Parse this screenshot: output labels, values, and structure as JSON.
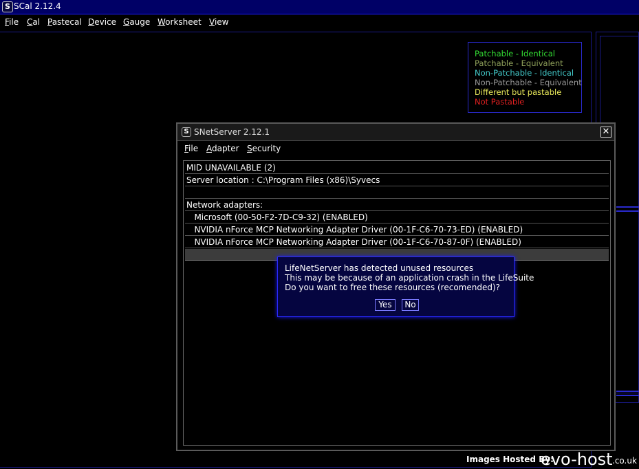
{
  "app": {
    "title": "SCal 2.12.4",
    "logo_letter": "S",
    "menu": [
      "File",
      "Cal",
      "Pastecal",
      "Device",
      "Gauge",
      "Worksheet",
      "View"
    ]
  },
  "legend": {
    "items": [
      {
        "label": "Patchable - Identical",
        "color": "#33dd33"
      },
      {
        "label": "Patchable - Equivalent",
        "color": "#8fa15a"
      },
      {
        "label": "Non-Patchable - Identical",
        "color": "#44cccc"
      },
      {
        "label": "Non-Patchable - Equivalent",
        "color": "#9a9a9a"
      },
      {
        "label": "Different but pastable",
        "color": "#e8e85a"
      },
      {
        "label": "Not Pastable",
        "color": "#e02020"
      }
    ]
  },
  "snetserver": {
    "title": "SNetServer 2.12.1",
    "logo_letter": "S",
    "close_label": "✕",
    "menu": [
      "File",
      "Adapter",
      "Security"
    ],
    "rows": [
      "MID UNAVAILABLE (2)",
      "Server location : C:\\Program Files (x86)\\Syvecs",
      "",
      "Network adapters:",
      "   Microsoft (00-50-F2-7D-C9-32) (ENABLED)",
      "   NVIDIA nForce MCP Networking Adapter Driver (00-1F-C6-70-73-ED) (ENABLED)",
      "   NVIDIA nForce MCP Networking Adapter Driver (00-1F-C6-70-87-0F) (ENABLED)",
      ""
    ]
  },
  "prompt": {
    "lines": [
      "LifeNetServer has detected unused resources",
      "This may be because of an application crash in the LifeSuite",
      "Do you want to free these resources (recomended)?"
    ],
    "yes_label": "Yes",
    "no_label": "No"
  },
  "footer": {
    "label": "Images Hosted By:",
    "logo": "evo-host",
    "tld": ".co.uk"
  },
  "colors": {
    "titlebar": "#000066",
    "accent_blue": "#2a2acf",
    "dialog_border": "#5a5a5a",
    "popup_bg": "#050540"
  }
}
